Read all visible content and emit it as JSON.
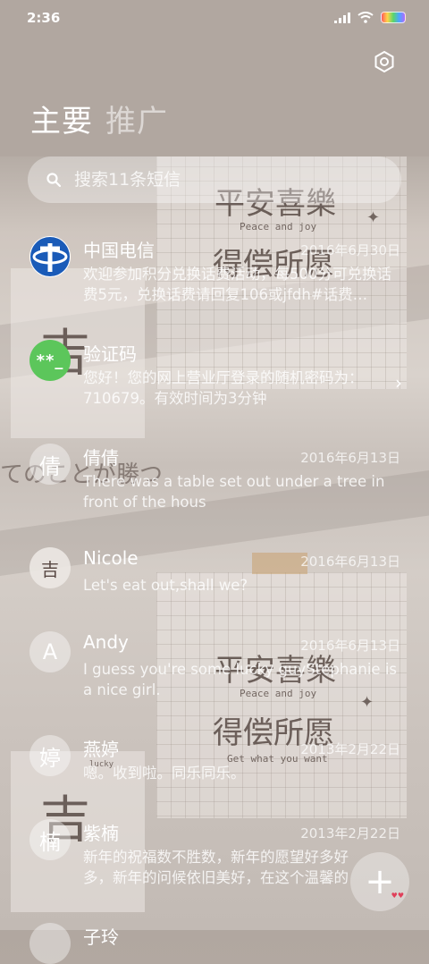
{
  "status_bar": {
    "time": "2:36"
  },
  "tabs": [
    {
      "label": "主要"
    },
    {
      "label": "推广"
    }
  ],
  "search": {
    "placeholder": "搜索11条短信"
  },
  "wallpaper": {
    "title_1": "平安喜樂",
    "subtitle_1": "Peace and joy",
    "title_2": "得偿所愿",
    "subtitle_2": "Get what you want",
    "big_char": "吉",
    "cursive": "てのことが勝つ",
    "lucky": "lucky"
  },
  "messages": [
    {
      "name": "中国电信",
      "date": "2016年6月30日",
      "preview": "欢迎参加积分兑换话费活动，每500分可兑换话费5元，兑换话费请回复106或jfdh#话费…",
      "avatar": "telecom-logo-icon"
    },
    {
      "name": "验证码",
      "date": "",
      "preview": "您好！您的网上营业厅登录的随机密码为：710679。有效时间为3分钟",
      "avatar_text": "**_"
    },
    {
      "name": "倩倩",
      "date": "2016年6月13日",
      "preview": "There was a table set out under a tree in front of the hous",
      "avatar_text": "倩"
    },
    {
      "name": "Nicole",
      "date": "2016年6月13日",
      "preview": "Let's eat out,shall we?",
      "avatar_text": "吉"
    },
    {
      "name": "Andy",
      "date": "2016年6月13日",
      "preview": "I guess you're some lucky guyStephanie is a nice girl.",
      "avatar_text": "A"
    },
    {
      "name": "燕婷",
      "date": "2013年2月22日",
      "preview": "嗯。收到啦。同乐同乐。",
      "avatar_text": "婷"
    },
    {
      "name": "紫楠",
      "date": "2013年2月22日",
      "preview": "新年的祝福数不胜数，新年的愿望好多好多，新年的问候依旧美好，在这个温馨的时刻，",
      "avatar_text": "楠"
    },
    {
      "name": "子玲",
      "date": "",
      "preview": "",
      "avatar_text": ""
    }
  ],
  "fab": {
    "label": "+"
  },
  "colors": {
    "verify_green": "#5cc65b",
    "telecom_blue": "#1a5bb8"
  }
}
